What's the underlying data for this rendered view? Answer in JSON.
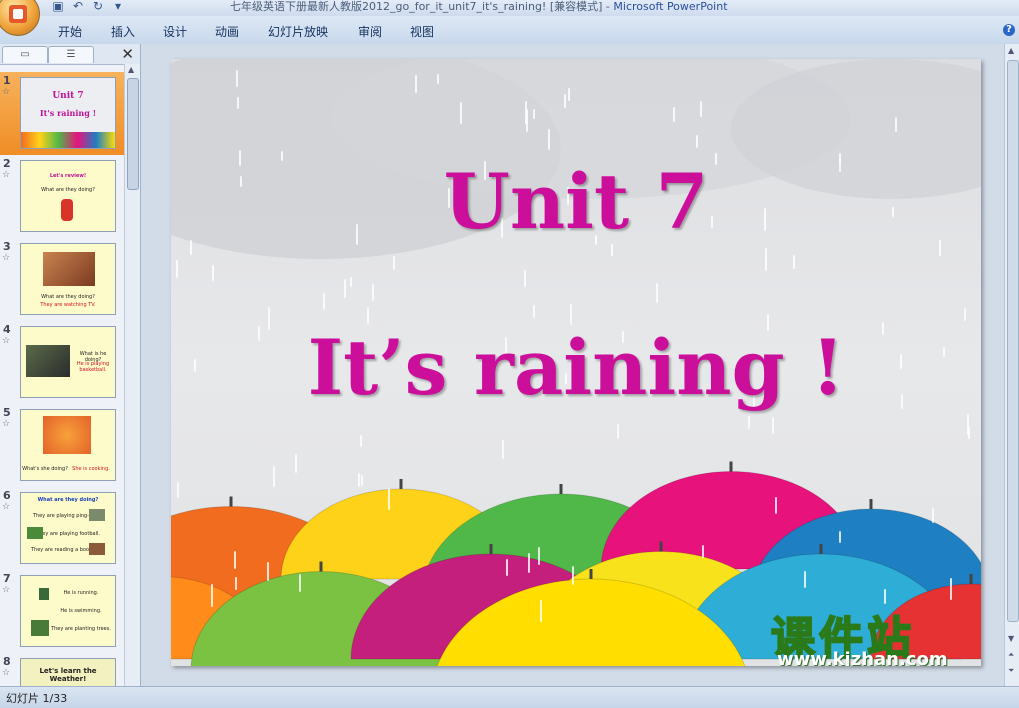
{
  "titlebar": {
    "title": "七年级英语下册最新人教版2012_go_for_it_unit7_it's_raining! [兼容模式] - ",
    "app_name": "Microsoft PowerPoint",
    "qat_icons": [
      "save-icon",
      "undo-icon",
      "redo-icon",
      "dropdown-icon"
    ]
  },
  "ribbon": {
    "tabs": [
      "开始",
      "插入",
      "设计",
      "动画",
      "幻灯片放映",
      "审阅",
      "视图"
    ],
    "help": "?"
  },
  "pane": {
    "tab_slides_icon": "slides-tab-icon",
    "tab_outline_icon": "outline-tab-icon",
    "close": "✕",
    "thumbnails": [
      {
        "num": "1",
        "lines": [
          "Unit 7",
          "It's raining !"
        ]
      },
      {
        "num": "2",
        "lines": [
          "Let's review!",
          "What are they doing?"
        ]
      },
      {
        "num": "3",
        "lines": [
          "What are they doing?",
          "They are watching TV."
        ]
      },
      {
        "num": "4",
        "lines": [
          "What is he doing?",
          "He is playing basketball."
        ]
      },
      {
        "num": "5",
        "lines": [
          "What's she doing?",
          "She is cooking."
        ]
      },
      {
        "num": "6",
        "lines": [
          "What are they doing?",
          "They are playing ping-pong.",
          "They are playing football.",
          "They are reading a book now."
        ]
      },
      {
        "num": "7",
        "lines": [
          "He is running.",
          "He is swimming.",
          "They are planting trees."
        ]
      },
      {
        "num": "8",
        "lines": [
          "Let's learn the Weather!"
        ]
      }
    ]
  },
  "slide": {
    "title_line1": "Unit 7",
    "title_line2": "It’s raining !",
    "watermark_cn": "课件站",
    "watermark_url": "www.kjzhan.com",
    "umbrella_colors": [
      "#f26c1f",
      "#ffd21a",
      "#4fb848",
      "#e8127c",
      "#1e7fc2",
      "#ff8b1a",
      "#7bc142",
      "#c51f7e",
      "#f7e21c",
      "#2eaed6",
      "#e63232",
      "#ffde00"
    ]
  },
  "status": {
    "text": "幻灯片 1/33"
  }
}
